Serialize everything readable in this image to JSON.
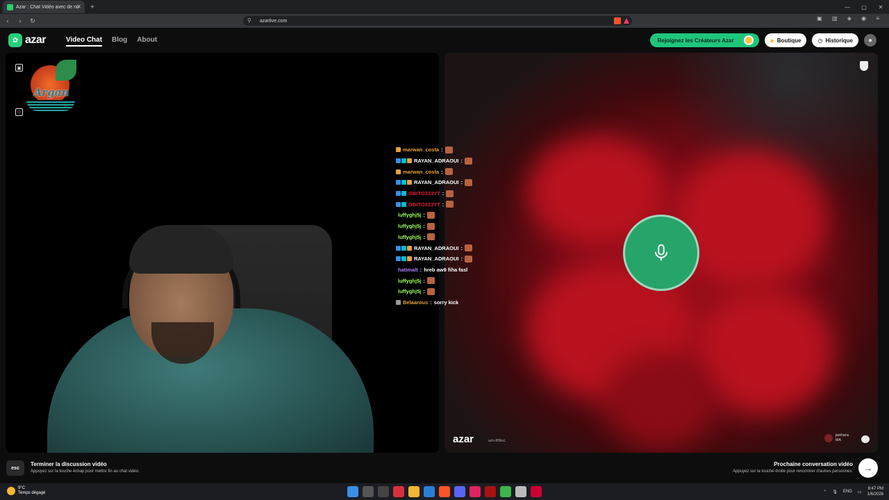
{
  "browser": {
    "tab_title": "Azar : Chat Vidéo avec de no",
    "url": "azarlive.com"
  },
  "site": {
    "logo_text": "azar",
    "nav": [
      {
        "label": "Video Chat",
        "active": true
      },
      {
        "label": "Blog",
        "active": false
      },
      {
        "label": "About",
        "active": false
      }
    ],
    "creators_button": "Rejoignez les Créateurs Azar",
    "shop_button": "Boutique",
    "history_button": "Historique"
  },
  "streamer_logo_text": "Argan",
  "chat": [
    {
      "user": "marwan_costa",
      "color": "#e6a23c",
      "badges": [
        "#e6a23c"
      ],
      "msg": "",
      "emote": true
    },
    {
      "user": "RAYAN_ADRAOUI",
      "color": "#ffffff",
      "badges": [
        "#3a8ee6",
        "#00bcd4",
        "#e6a23c"
      ],
      "msg": "",
      "emote": true
    },
    {
      "user": "marwan_costa",
      "color": "#e6a23c",
      "badges": [
        "#e6a23c"
      ],
      "msg": "",
      "emote": true
    },
    {
      "user": "RAYAN_ADRAOUI",
      "color": "#ffffff",
      "badges": [
        "#3a8ee6",
        "#00bcd4",
        "#e6a23c"
      ],
      "msg": "",
      "emote": true
    },
    {
      "user": "OBITO333YT",
      "color": "#e0203a",
      "badges": [
        "#3a8ee6",
        "#00bcd4"
      ],
      "msg": "",
      "emote": true
    },
    {
      "user": "OBITO333YT",
      "color": "#e0203a",
      "badges": [
        "#3a8ee6",
        "#00bcd4"
      ],
      "msg": "",
      "emote": true
    },
    {
      "user": "luffyghj5j",
      "color": "#9cff57",
      "badges": [],
      "msg": "",
      "emote": true
    },
    {
      "user": "luffyghj5j",
      "color": "#9cff57",
      "badges": [],
      "msg": "",
      "emote": true
    },
    {
      "user": "luffyghj5j",
      "color": "#9cff57",
      "badges": [],
      "msg": "",
      "emote": true
    },
    {
      "user": "RAYAN_ADRAOUI",
      "color": "#ffffff",
      "badges": [
        "#3a8ee6",
        "#00bcd4",
        "#e6a23c"
      ],
      "msg": "",
      "emote": true
    },
    {
      "user": "RAYAN_ADRAOUI",
      "color": "#ffffff",
      "badges": [
        "#3a8ee6",
        "#00bcd4",
        "#e6a23c"
      ],
      "msg": "",
      "emote": true
    },
    {
      "user": "hatimalt",
      "color": "#b07cff",
      "badges": [],
      "msg": "hreb aw9 fiha fasl",
      "emote": false
    },
    {
      "user": "luffyghj5j",
      "color": "#9cff57",
      "badges": [],
      "msg": "",
      "emote": true
    },
    {
      "user": "luffyghj5j",
      "color": "#9cff57",
      "badges": [],
      "msg": "",
      "emote": true
    },
    {
      "user": "Belaarous",
      "color": "#e6a23c",
      "badges": [
        "#999999"
      ],
      "msg": "sorry kick",
      "emote": false
    }
  ],
  "partner": {
    "watermark": "azar",
    "id_text": "azlv-8f9kxL",
    "name": "jawhara",
    "country": "MA"
  },
  "bottom": {
    "esc_key": "esc",
    "end_title": "Terminer la discussion vidéo",
    "end_sub": "Appuyez sur la touche échap pour mettre fin au chat vidéo.",
    "next_title": "Prochaine conversation vidéo",
    "next_sub": "Appuyez sur la touche droite pour rencontrer d'autres personnes."
  },
  "taskbar": {
    "temp": "9°C",
    "weather": "Temps dégagé",
    "lang": "ENG",
    "time": "8:47 PM",
    "date": "1/6/2026"
  }
}
